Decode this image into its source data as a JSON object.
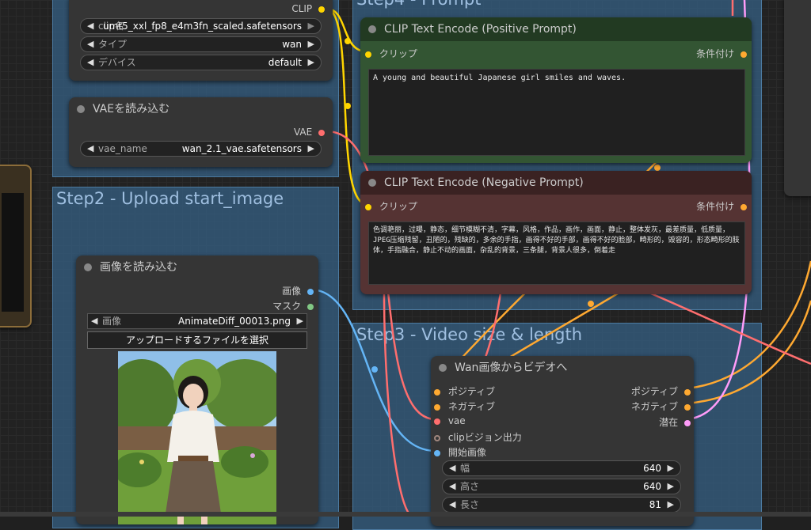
{
  "groups": {
    "step2_title": "Step2 - Upload start_image",
    "step3_title": "Step3 - Video size & length",
    "step4_title": "Step4 - Prompt"
  },
  "clip_loader": {
    "output_label": "CLIP",
    "widgets": [
      {
        "label": "clip名",
        "value": "umt5_xxl_fp8_e4m3fn_scaled.safetensors"
      },
      {
        "label": "タイプ",
        "value": "wan"
      },
      {
        "label": "デバイス",
        "value": "default"
      }
    ]
  },
  "vae_loader": {
    "title": "VAEを読み込む",
    "output_label": "VAE",
    "widget": {
      "label": "vae_name",
      "value": "wan_2.1_vae.safetensors"
    }
  },
  "load_image": {
    "title": "画像を読み込む",
    "outputs": [
      "画像",
      "マスク"
    ],
    "widget": {
      "label": "画像",
      "value": "AnimateDiff_00013.png"
    },
    "upload_button": "アップロードするファイルを選択"
  },
  "clip_pos": {
    "title": "CLIP Text Encode (Positive Prompt)",
    "input_label": "クリップ",
    "output_label": "条件付け",
    "text": "A young and beautiful Japanese girl smiles and waves."
  },
  "clip_neg": {
    "title": "CLIP Text Encode (Negative Prompt)",
    "input_label": "クリップ",
    "output_label": "条件付け",
    "text": "色调艳丽，过曝，静态，细节模糊不清，字幕，风格，作品，画作，画面，静止，整体发灰，最差质量，低质量，JPEG压缩残留，丑陋的，残缺的，多余的手指，画得不好的手部，画得不好的脸部，畸形的，毁容的，形态畸形的肢体，手指融合，静止不动的画面，杂乱的背景，三条腿，背景人很多，倒着走"
  },
  "wan_node": {
    "title": "Wan画像からビデオへ",
    "inputs": [
      "ポジティブ",
      "ネガティブ",
      "vae",
      "clipビジョン出力",
      "開始画像"
    ],
    "outputs": [
      "ポジティブ",
      "ネガティブ",
      "潜在"
    ],
    "widgets": [
      {
        "label": "幅",
        "value": "640"
      },
      {
        "label": "高さ",
        "value": "640"
      },
      {
        "label": "長さ",
        "value": "81"
      }
    ]
  },
  "colors": {
    "clip": "#ffd500",
    "vae": "#ff6e6e",
    "image": "#64b5f6",
    "cond": "#ffa931",
    "latent": "#ff9cf9",
    "positive_node": "#335533",
    "negative_node": "#553333"
  }
}
